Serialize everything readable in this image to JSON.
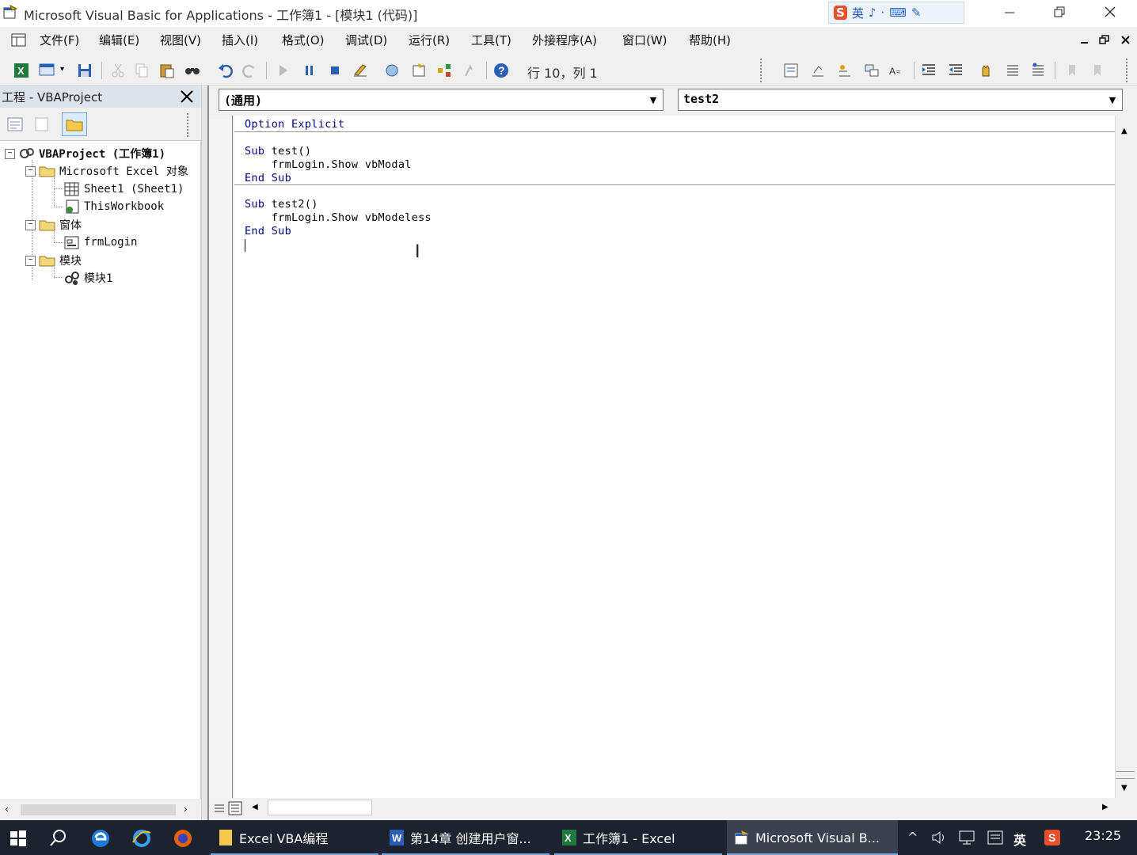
{
  "window": {
    "title": "Microsoft Visual Basic for Applications - 工作簿1 - [模块1 (代码)]",
    "ime": [
      "S",
      "英",
      "♪",
      "·",
      "⌨",
      "✎"
    ]
  },
  "menu": [
    "文件(F)",
    "编辑(E)",
    "视图(V)",
    "插入(I)",
    "格式(O)",
    "调试(D)",
    "运行(R)",
    "工具(T)",
    "外接程序(A)",
    "窗口(W)",
    "帮助(H)"
  ],
  "toolbar": {
    "cursor_position": "行 10，列 1"
  },
  "project": {
    "title": "工程 - VBAProject",
    "tree": {
      "root": "VBAProject (工作簿1)",
      "excel_objects": "Microsoft Excel 对象",
      "sheet1": "Sheet1 (Sheet1)",
      "thisworkbook": "ThisWorkbook",
      "forms": "窗体",
      "frmlogin": "frmLogin",
      "modules": "模块",
      "module1": "模块1"
    }
  },
  "code": {
    "object_combo": "(通用)",
    "proc_combo": "test2",
    "lines": {
      "l1": "Option Explicit",
      "l3a": "Sub",
      "l3b": " test()",
      "l4": "    frmLogin.Show vbModal",
      "l5": "End Sub",
      "l7a": "Sub",
      "l7b": " test2()",
      "l8": "    frmLogin.Show vbModeless",
      "l9": "End Sub"
    }
  },
  "taskbar": {
    "items": [
      "Excel VBA编程",
      "第14章 创建用户窗...",
      "工作簿1 - Excel",
      "Microsoft Visual B..."
    ],
    "ime": "英",
    "time": "23:25"
  },
  "colors": {
    "keyword": "#00007f",
    "taskbar": "#1c2330",
    "panel_header": "#dde3ea"
  }
}
